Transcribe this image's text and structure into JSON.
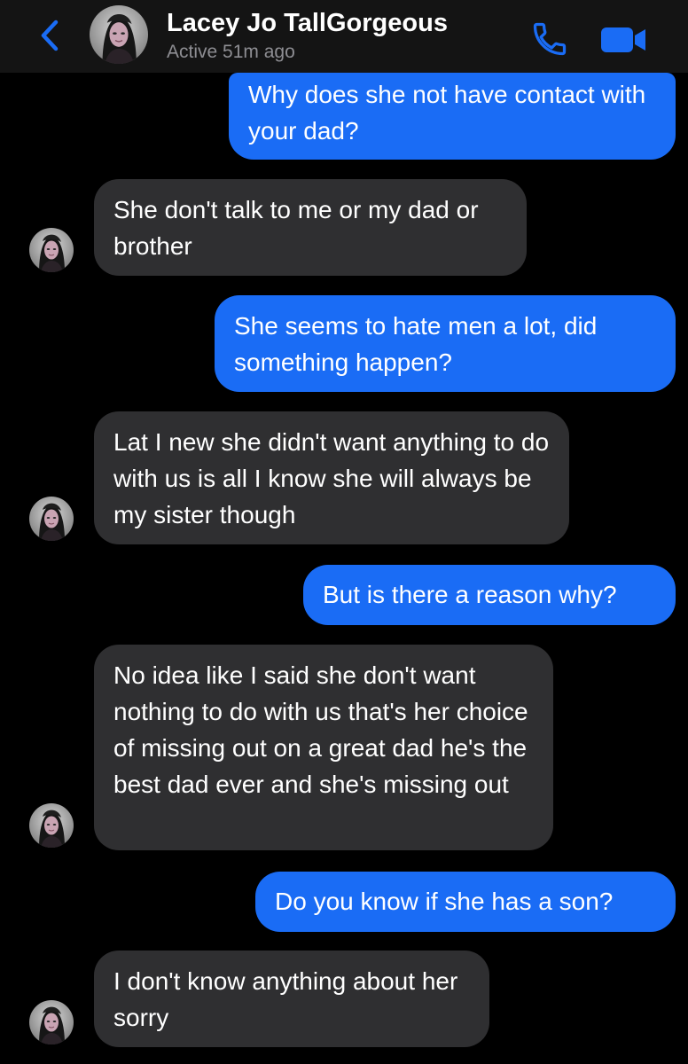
{
  "header": {
    "contact_name": "Lacey Jo TallGorgeous",
    "status": "Active 51m ago",
    "back_icon": "chevron-left-icon",
    "call_icon": "phone-icon",
    "video_icon": "video-camera-icon",
    "accent_color": "#1a6cf5"
  },
  "messages": [
    {
      "direction": "outgoing",
      "text": "Why does she not have contact with your dad?"
    },
    {
      "direction": "incoming",
      "text": "She don't talk to me or my dad or brother"
    },
    {
      "direction": "outgoing",
      "text": "She seems to hate men a lot, did something happen?"
    },
    {
      "direction": "incoming",
      "text": "Lat I new she didn't want anything to do with us is all I know she will always be my sister though"
    },
    {
      "direction": "outgoing",
      "text": "But is there a reason why?"
    },
    {
      "direction": "incoming",
      "text": "No idea like I said she don't want nothing to do with us that's her choice of missing out on a great dad he's the best dad ever and she's missing out"
    },
    {
      "direction": "outgoing",
      "text": "Do you know if she has a son?"
    },
    {
      "direction": "incoming",
      "text": "I don't know anything about her sorry"
    }
  ],
  "colors": {
    "outgoing_bubble": "#1a6cf5",
    "incoming_bubble": "#2f2f31",
    "background": "#000000",
    "header_background": "#141414"
  }
}
